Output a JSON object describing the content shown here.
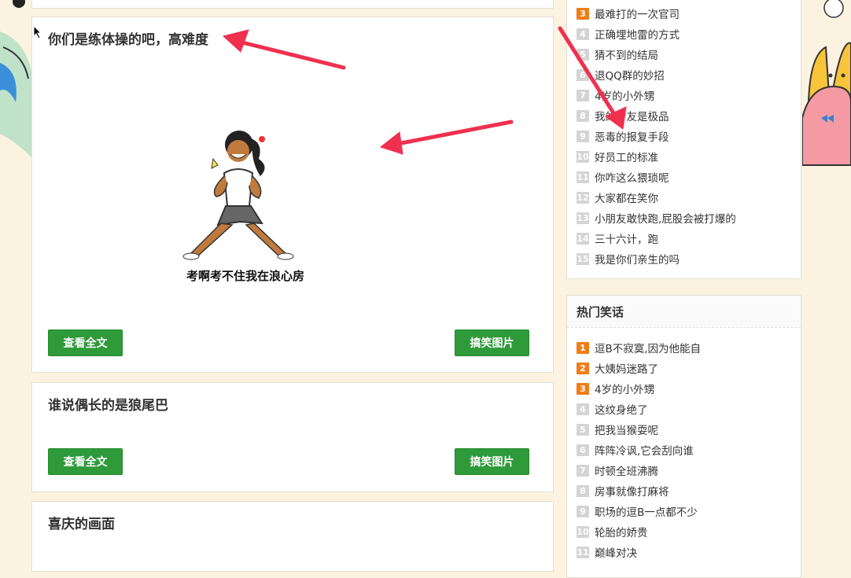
{
  "cards": [
    {
      "title": "你们是练体操的吧，高难度",
      "caption": "考啊考不住我在浪心房",
      "read_more": "查看全文",
      "category": "搞笑图片"
    },
    {
      "title": "谁说偶长的是狼尾巴",
      "read_more": "查看全文",
      "category": "搞笑图片"
    },
    {
      "title": "喜庆的画面"
    }
  ],
  "top_list": {
    "items": [
      {
        "num": "3",
        "text": "最难打的一次官司"
      },
      {
        "num": "4",
        "text": "正确埋地雷的方式"
      },
      {
        "num": "5",
        "text": "猜不到的结局"
      },
      {
        "num": "6",
        "text": "退QQ群的妙招"
      },
      {
        "num": "7",
        "text": "4岁的小外甥"
      },
      {
        "num": "8",
        "text": "我的舍友是极品"
      },
      {
        "num": "9",
        "text": "恶毒的报复手段"
      },
      {
        "num": "10",
        "text": "好员工的标准"
      },
      {
        "num": "11",
        "text": "你咋这么猥琐呢"
      },
      {
        "num": "12",
        "text": "大家都在笑你"
      },
      {
        "num": "13",
        "text": "小朋友敢快跑,屁股会被打爆的"
      },
      {
        "num": "14",
        "text": "三十六计，跑"
      },
      {
        "num": "15",
        "text": "我是你们亲生的吗"
      }
    ]
  },
  "hot_jokes": {
    "title": "热门笑话",
    "items": [
      {
        "num": "1",
        "text": "逗B不寂寞,因为他能自"
      },
      {
        "num": "2",
        "text": "大姨妈迷路了"
      },
      {
        "num": "3",
        "text": "4岁的小外甥"
      },
      {
        "num": "4",
        "text": "这纹身绝了"
      },
      {
        "num": "5",
        "text": "把我当猴耍呢"
      },
      {
        "num": "6",
        "text": "阵阵冷讽,它会刮向谁"
      },
      {
        "num": "7",
        "text": "时顿全班沸腾"
      },
      {
        "num": "8",
        "text": "房事就像打麻将"
      },
      {
        "num": "9",
        "text": "职场的逗B一点都不少"
      },
      {
        "num": "10",
        "text": "轮胎的娇贵"
      },
      {
        "num": "11",
        "text": "巅峰对决"
      }
    ]
  },
  "colors": {
    "background": "#fbf3e0",
    "button": "#2f9a3a",
    "rank_hot": "#f07d18",
    "rank_normal": "#d4d4d4",
    "annotation_arrow": "#f0304f"
  },
  "icons": [
    "cursor-icon",
    "cartoon-girl-exercise",
    "cartoon-bunny-decoration",
    "annotation-arrow"
  ]
}
